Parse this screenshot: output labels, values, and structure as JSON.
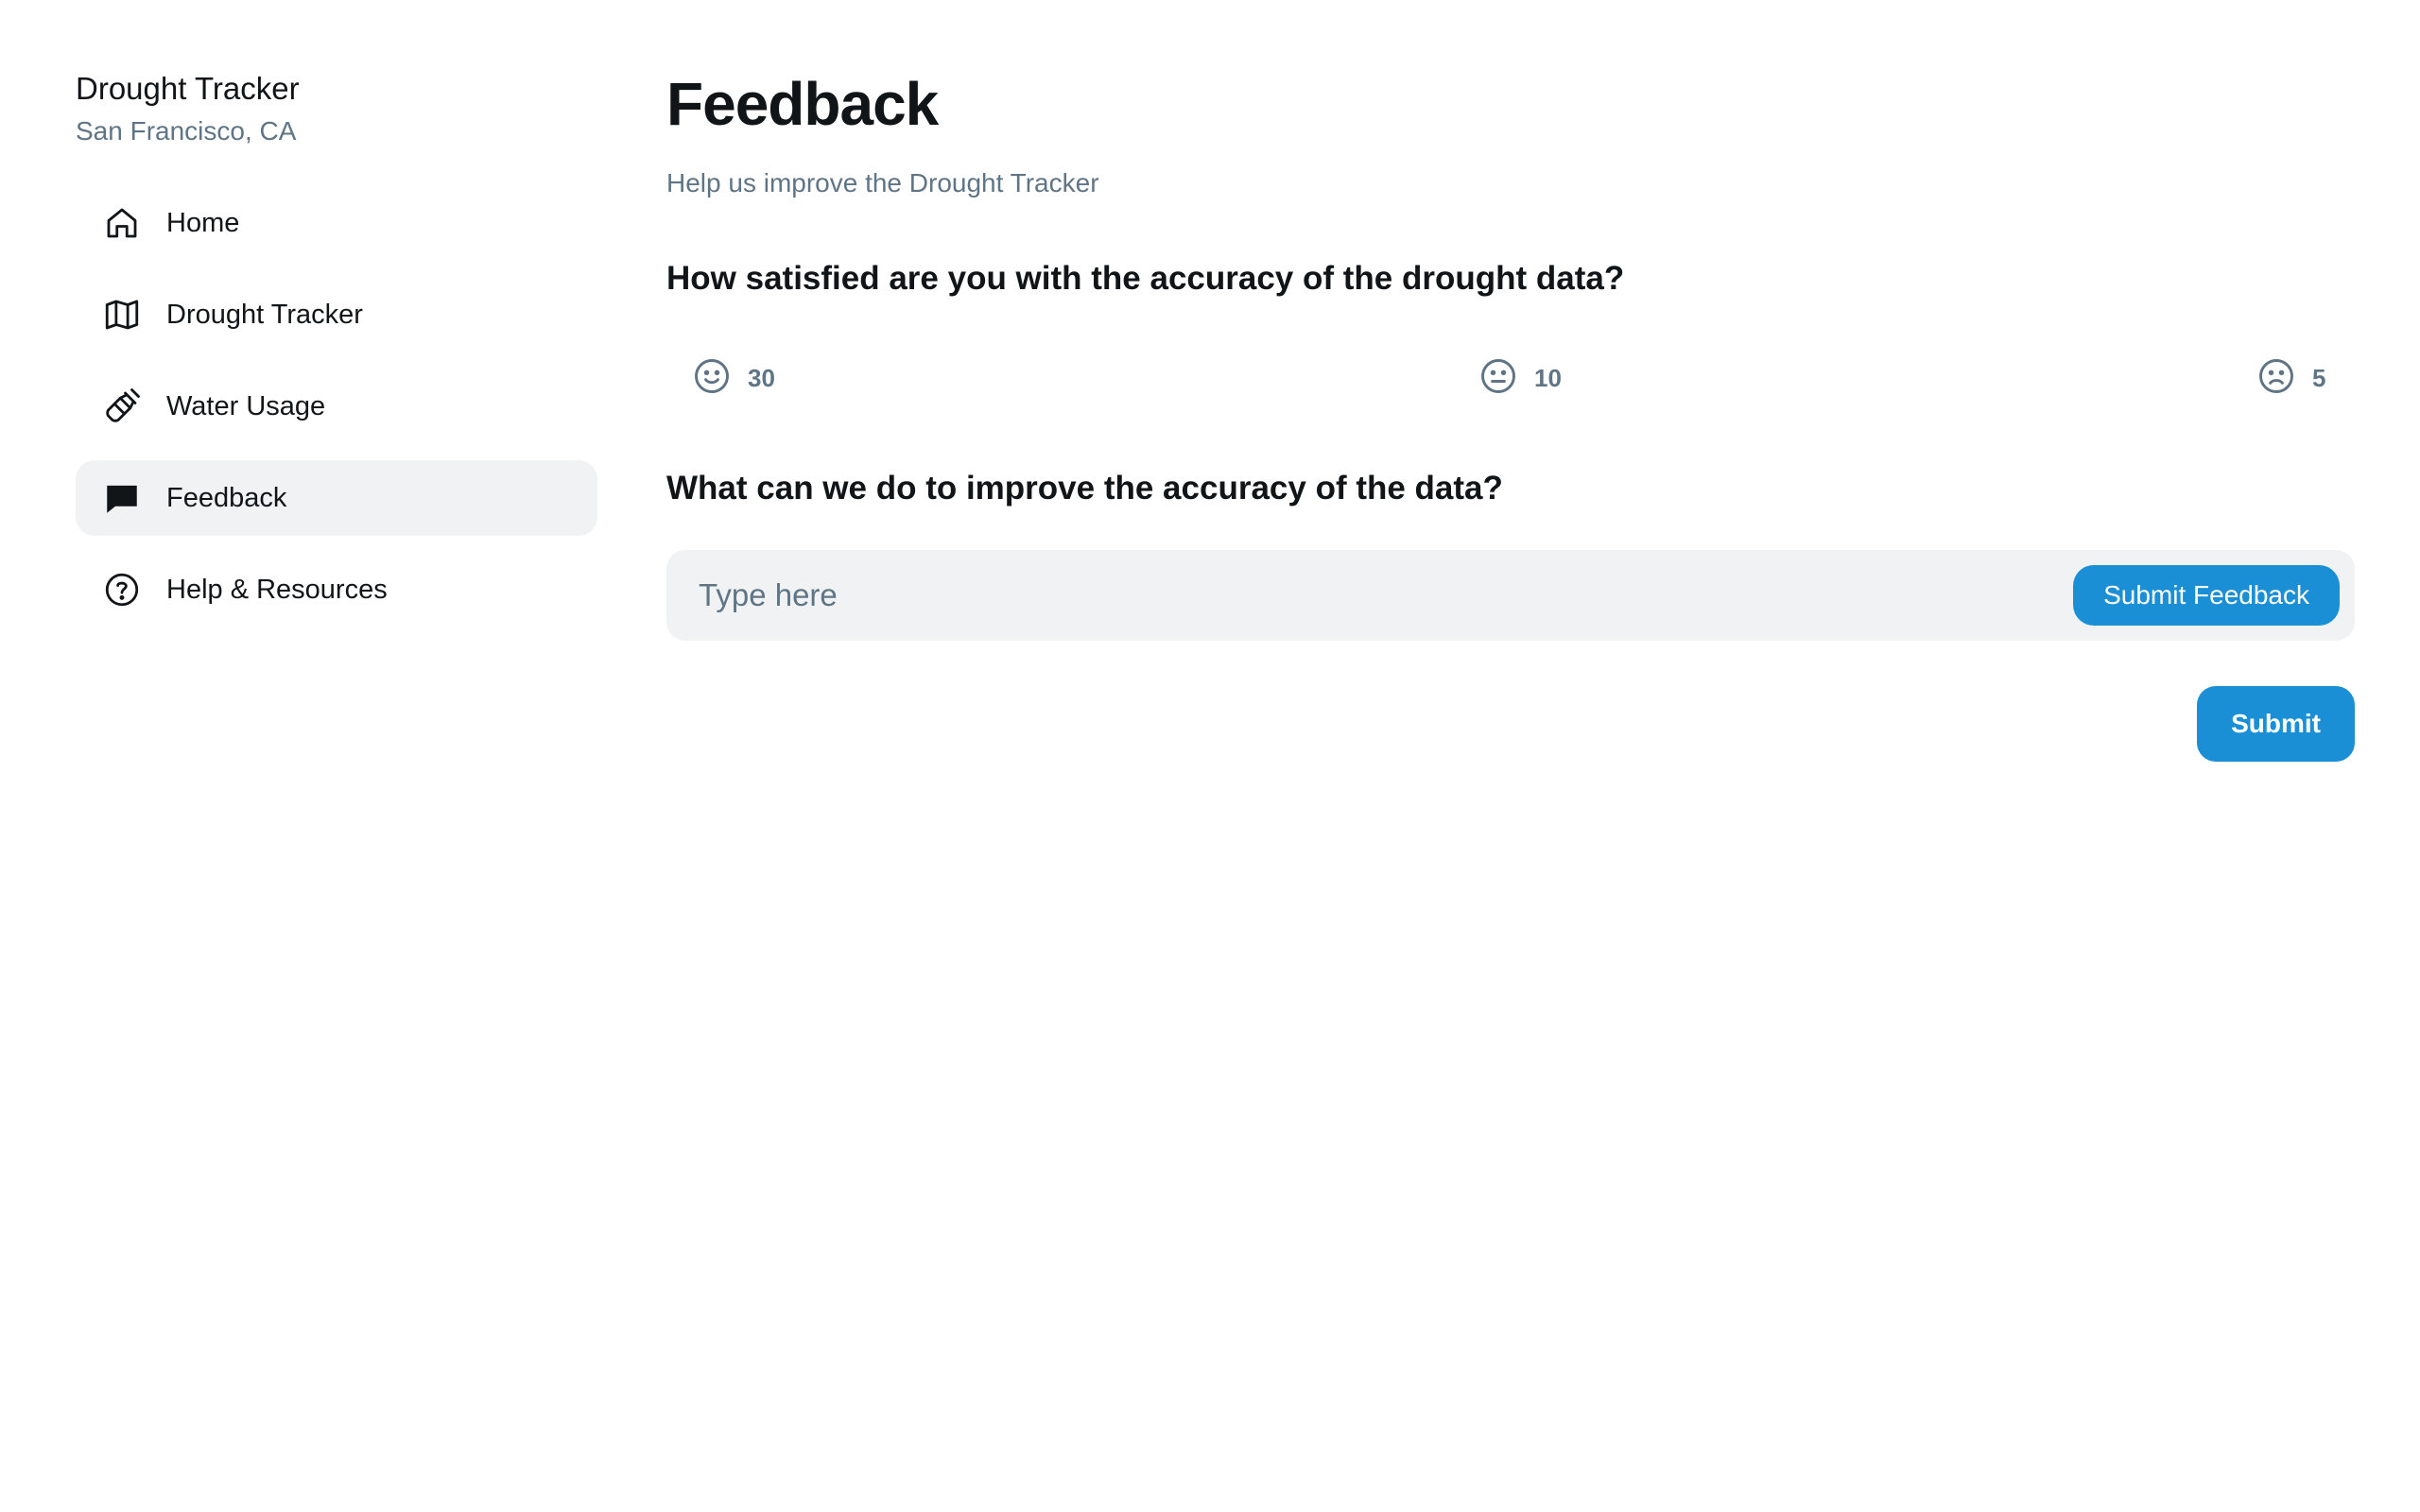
{
  "sidebar": {
    "title": "Drought Tracker",
    "subtitle": "San Francisco, CA",
    "items": [
      {
        "label": "Home",
        "icon": "home-icon",
        "active": false
      },
      {
        "label": "Drought Tracker",
        "icon": "map-icon",
        "active": false
      },
      {
        "label": "Water Usage",
        "icon": "spray-bottle-icon",
        "active": false
      },
      {
        "label": "Feedback",
        "icon": "chat-bubble-icon",
        "active": true
      },
      {
        "label": "Help & Resources",
        "icon": "question-circle-icon",
        "active": false
      }
    ]
  },
  "main": {
    "title": "Feedback",
    "subtitle": "Help us improve the Drought Tracker",
    "question1": "How satisfied are you with the accuracy of the drought data?",
    "ratings": [
      {
        "icon": "smile-icon",
        "count": "30"
      },
      {
        "icon": "neutral-face-icon",
        "count": "10"
      },
      {
        "icon": "sad-face-icon",
        "count": "5"
      }
    ],
    "question2": "What can we do to improve the accuracy of the data?",
    "input": {
      "placeholder": "Type here",
      "value": ""
    },
    "inline_button_label": "Submit Feedback",
    "submit_label": "Submit"
  },
  "colors": {
    "accent": "#1a8fd6",
    "muted_text": "#5f7585",
    "active_nav_bg": "#f0f2f4",
    "input_bg": "#f0f2f4",
    "text": "#111518"
  }
}
